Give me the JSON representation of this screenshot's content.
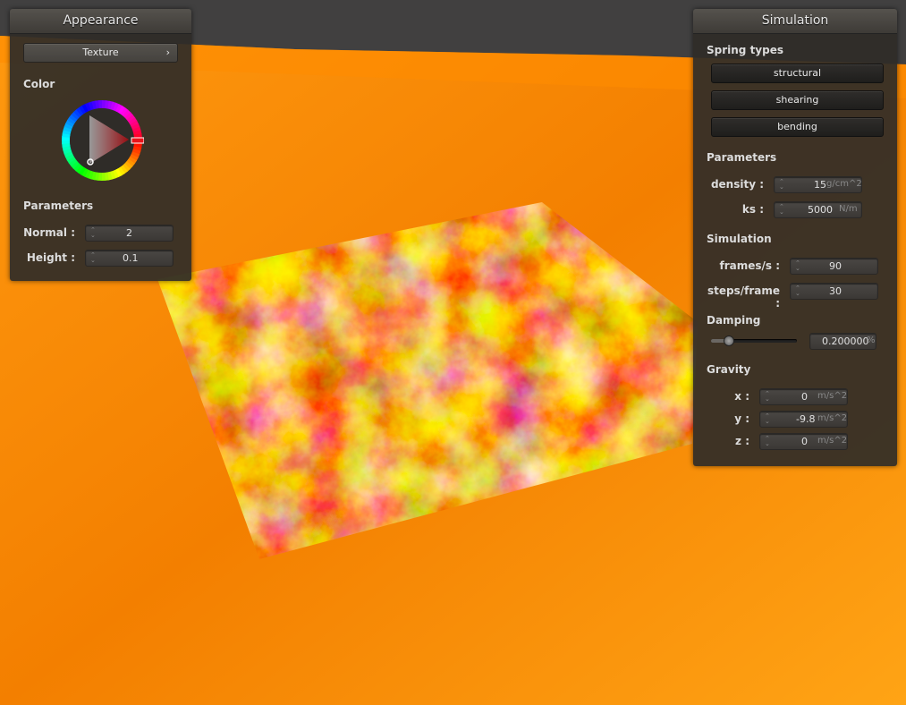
{
  "appearance": {
    "title": "Appearance",
    "texture_label": "Texture",
    "color_section": "Color",
    "params_section": "Parameters",
    "normal_label": "Normal :",
    "normal_value": "2",
    "height_label": "Height :",
    "height_value": "0.1"
  },
  "simulation": {
    "title": "Simulation",
    "spring_section": "Spring types",
    "spring_buttons": [
      "structural",
      "shearing",
      "bending"
    ],
    "params_section": "Parameters",
    "density_label": "density :",
    "density_value": "15",
    "density_unit": "g/cm^2",
    "ks_label": "ks :",
    "ks_value": "5000",
    "ks_unit": "N/m",
    "sim_section": "Simulation",
    "fps_label": "frames/s :",
    "fps_value": "90",
    "steps_label": "steps/frame :",
    "steps_value": "30",
    "damping_section": "Damping",
    "damping_value": "0.200000",
    "damping_unit": "%",
    "damping_fraction": 0.2,
    "gravity_section": "Gravity",
    "gx_label": "x :",
    "gx_value": "0",
    "gy_label": "y :",
    "gy_value": "-9.8",
    "gz_label": "z :",
    "gz_value": "0",
    "g_unit": "m/s^2"
  },
  "colors": {
    "selected_color": "#e8141b",
    "lava_orange": "#f07d00",
    "panel_bg": "#2f2c28"
  },
  "icons": {
    "texture_arrow": "chevron-right-icon",
    "spinner": "spinner-arrows-icon"
  }
}
